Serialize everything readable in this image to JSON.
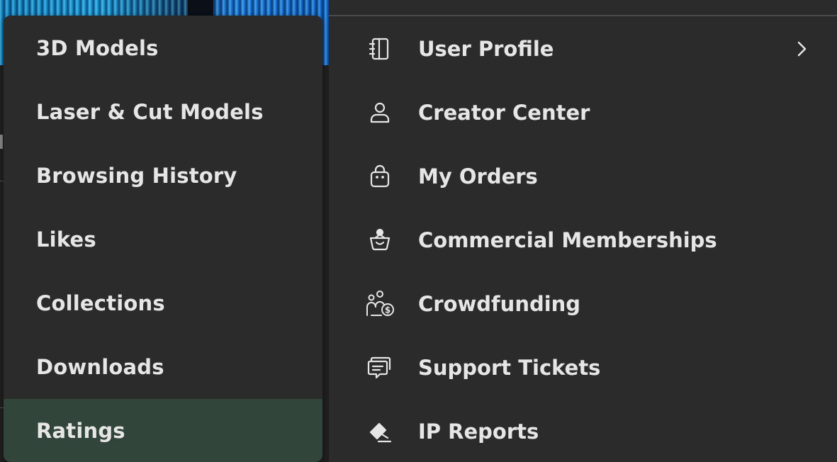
{
  "left_menu": {
    "items": [
      {
        "label": "3D Models"
      },
      {
        "label": "Laser & Cut Models"
      },
      {
        "label": "Browsing History"
      },
      {
        "label": "Likes"
      },
      {
        "label": "Collections"
      },
      {
        "label": "Downloads"
      },
      {
        "label": "Ratings",
        "active": true
      }
    ]
  },
  "right_menu": {
    "items": [
      {
        "label": "User Profile",
        "icon": "notebook-icon",
        "has_submenu": true
      },
      {
        "label": "Creator Center",
        "icon": "user-icon"
      },
      {
        "label": "My Orders",
        "icon": "shopping-bag-icon"
      },
      {
        "label": "Commercial Memberships",
        "icon": "membership-basket-icon"
      },
      {
        "label": "Crowdfunding",
        "icon": "crowdfunding-icon"
      },
      {
        "label": "Support Tickets",
        "icon": "chat-ticket-icon"
      },
      {
        "label": "IP Reports",
        "icon": "gavel-icon"
      }
    ]
  },
  "colors": {
    "menu_bg": "#2b2b2b",
    "active_bg": "#31453a",
    "text": "#e6e6e6",
    "divider": "#4a4a4a"
  }
}
